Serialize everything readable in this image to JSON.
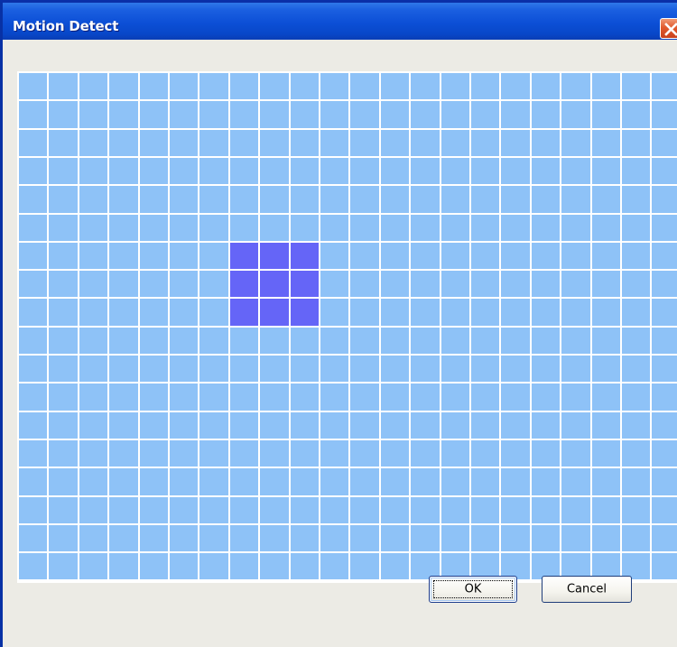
{
  "window": {
    "title": "Motion Detect"
  },
  "titlebar": {
    "close_icon": "close-icon",
    "accent_color": "#0a4fd0",
    "close_color": "#e15a2d"
  },
  "grid": {
    "columns": 22,
    "rows": 18,
    "cell_color": "#8ec2f7",
    "selected_color": "#6565f7",
    "selected_cells": [
      [
        6,
        7
      ],
      [
        6,
        8
      ],
      [
        6,
        9
      ],
      [
        7,
        7
      ],
      [
        7,
        8
      ],
      [
        7,
        9
      ],
      [
        8,
        7
      ],
      [
        8,
        8
      ],
      [
        8,
        9
      ]
    ]
  },
  "buttons": {
    "ok_label": "OK",
    "cancel_label": "Cancel"
  }
}
